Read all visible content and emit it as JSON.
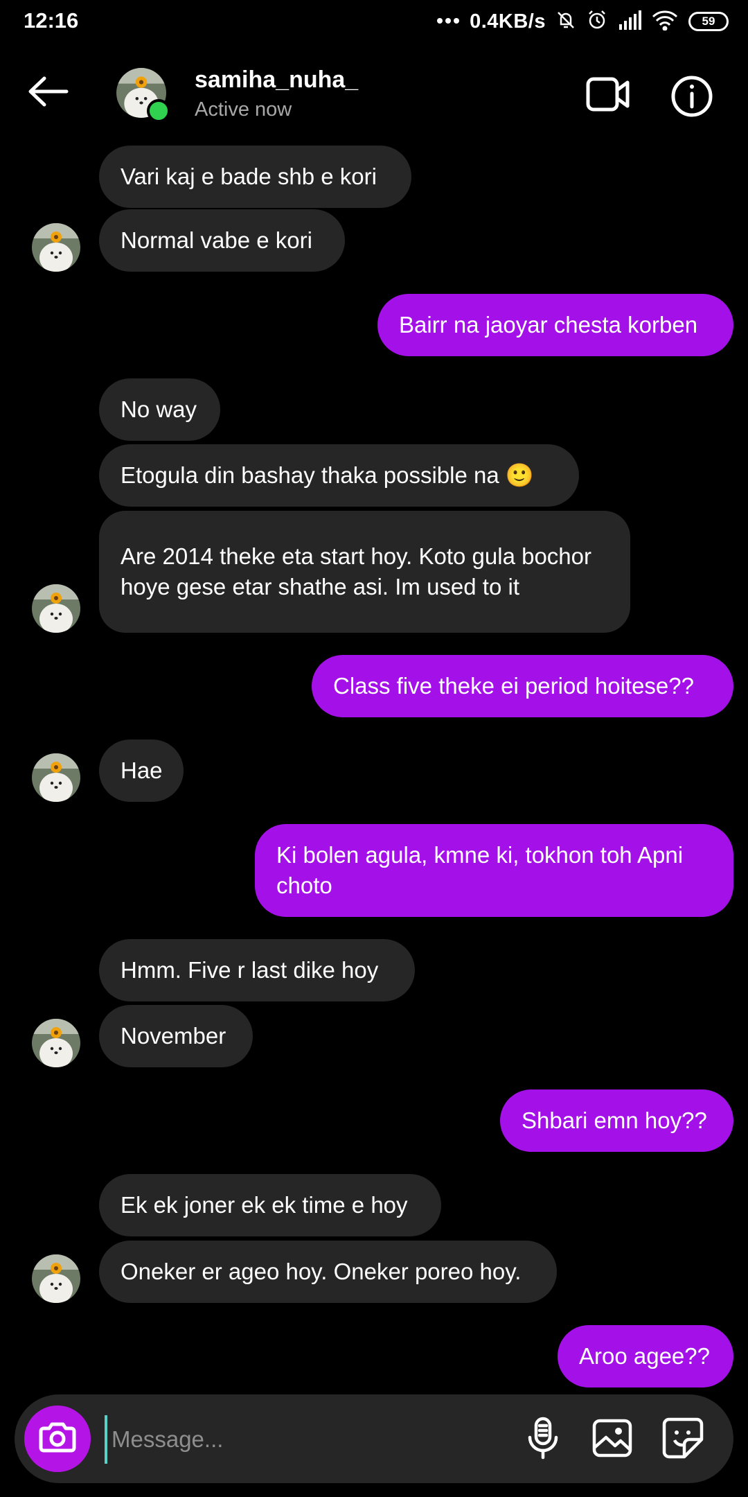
{
  "status_bar": {
    "time": "12:16",
    "network_speed": "0.4KB/s",
    "battery": "59",
    "icons": [
      "dots-icon",
      "mute-bell-icon",
      "alarm-icon",
      "signal-icon",
      "wifi-icon",
      "battery-icon"
    ]
  },
  "header": {
    "username": "samiha_nuha_",
    "status": "Active now",
    "online_color": "#2fd14f"
  },
  "messages": [
    {
      "from": "them",
      "text": "Vari kaj e bade shb e kori"
    },
    {
      "from": "them",
      "text": "Normal vabe e kori"
    },
    {
      "from": "me",
      "text": "Bairr na jaoyar chesta korben"
    },
    {
      "from": "them",
      "text": "No way"
    },
    {
      "from": "them",
      "text": "Etogula din bashay thaka possible na 🙂"
    },
    {
      "from": "them",
      "text": "Are 2014 theke eta start hoy. Koto gula bochor hoye gese etar shathe asi. Im used to it"
    },
    {
      "from": "me",
      "text": "Class five theke ei period hoitese??"
    },
    {
      "from": "them",
      "text": "Hae"
    },
    {
      "from": "me",
      "text": "Ki bolen agula, kmne ki, tokhon toh Apni choto"
    },
    {
      "from": "them",
      "text": "Hmm. Five r last dike hoy"
    },
    {
      "from": "them",
      "text": "November"
    },
    {
      "from": "me",
      "text": "Shbari emn hoy??"
    },
    {
      "from": "them",
      "text": "Ek ek joner ek ek time e hoy"
    },
    {
      "from": "them",
      "text": "Oneker er ageo hoy. Oneker poreo hoy."
    },
    {
      "from": "me",
      "text": "Aroo agee??"
    }
  ],
  "composer": {
    "placeholder": "Message..."
  },
  "colors": {
    "outgoing_bubble": "#a310e8",
    "incoming_bubble": "#262626",
    "camera_button": "#b514e6",
    "background": "#000000"
  }
}
